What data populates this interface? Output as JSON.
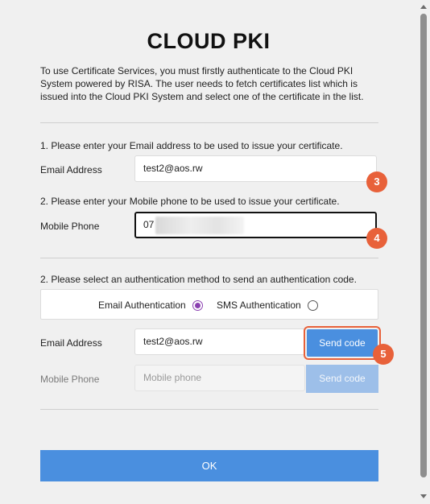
{
  "title": "CLOUD PKI",
  "intro": "To use Certificate Services, you must firstly authenticate to the Cloud PKI System powered by RISA. The user needs to fetch certificates list which is issued into the Cloud PKI System and select one of the certificate in the list.",
  "step1": {
    "text": "1. Please enter your Email address to be used to issue your certificate.",
    "label": "Email Address",
    "value": "test2@aos.rw"
  },
  "step2": {
    "text": "2. Please enter your Mobile phone to be used to issue your certificate.",
    "label": "Mobile Phone",
    "value": "07"
  },
  "step3": {
    "text": "2. Please select an authentication method to send an authentication code.",
    "email_auth_label": "Email Authentication",
    "sms_auth_label": "SMS Authentication",
    "selected": "email"
  },
  "auth_email": {
    "label": "Email Address",
    "value": "test2@aos.rw",
    "button": "Send code"
  },
  "auth_phone": {
    "label": "Mobile Phone",
    "placeholder": "Mobile phone",
    "button": "Send code"
  },
  "badges": {
    "email": "3",
    "phone": "4",
    "send": "5"
  },
  "ok_button": "OK",
  "colors": {
    "accent_blue": "#4a8fdf",
    "disabled_blue": "#9dbfe9",
    "badge_orange": "#e8613a",
    "radio_purple": "#8a3fb0"
  }
}
